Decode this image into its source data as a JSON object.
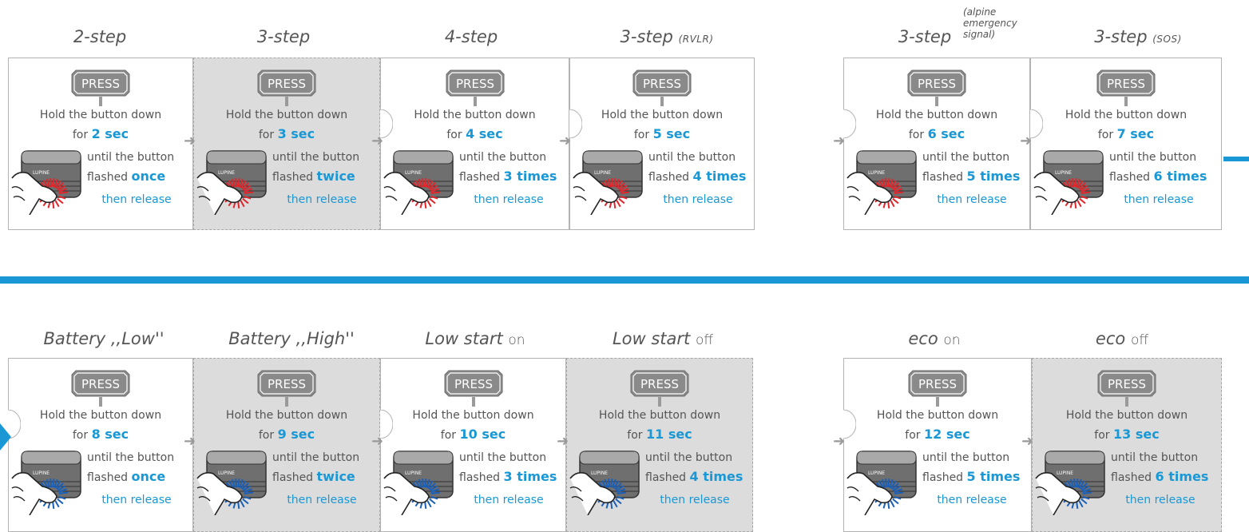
{
  "colors": {
    "accent": "#1a98d5",
    "card_grey": "#dcdcdc",
    "text": "#555555",
    "press_bg": "#8a8a8a",
    "red": "#e0262b",
    "blue": "#1a5fb8"
  },
  "common": {
    "press": "PRESS",
    "hold": "Hold the button down",
    "for": "for",
    "until": "until the button",
    "flashed": "flashed",
    "release": "then release"
  },
  "top": {
    "t1": "2-step",
    "t2": "3-step",
    "t3": "4-step",
    "t4": "3-step",
    "t4sub": "(RVLR)",
    "t5": "3-step",
    "t5note": "(alpine emergency signal)",
    "t6": "3-step",
    "t6sub": "(SOS)",
    "c1": {
      "sec": "2 sec",
      "count": "once"
    },
    "c2": {
      "sec": "3 sec",
      "count": "twice"
    },
    "c3": {
      "sec": "4 sec",
      "count": "3 times"
    },
    "c4": {
      "sec": "5 sec",
      "count": "4 times"
    },
    "c5": {
      "sec": "6 sec",
      "count": "5 times"
    },
    "c6": {
      "sec": "7 sec",
      "count": "6 times"
    }
  },
  "bottom": {
    "t1": "Battery ,,Low''",
    "t2": "Battery ,,High''",
    "t3": "Low start",
    "t3w": "on",
    "t4": "Low start",
    "t4w": "off",
    "t5": "eco",
    "t5w": "on",
    "t6": "eco",
    "t6w": "off",
    "c1": {
      "sec": "8 sec",
      "count": "once"
    },
    "c2": {
      "sec": "9 sec",
      "count": "twice"
    },
    "c3": {
      "sec": "10 sec",
      "count": "3 times"
    },
    "c4": {
      "sec": "11 sec",
      "count": "4 times"
    },
    "c5": {
      "sec": "12 sec",
      "count": "5 times"
    },
    "c6": {
      "sec": "13 sec",
      "count": "6 times"
    }
  },
  "icons": {
    "arrow": "arrow-right-icon",
    "press": "press-button-icon",
    "device": "lupine-lamp-icon",
    "brand": "LUPINE"
  }
}
